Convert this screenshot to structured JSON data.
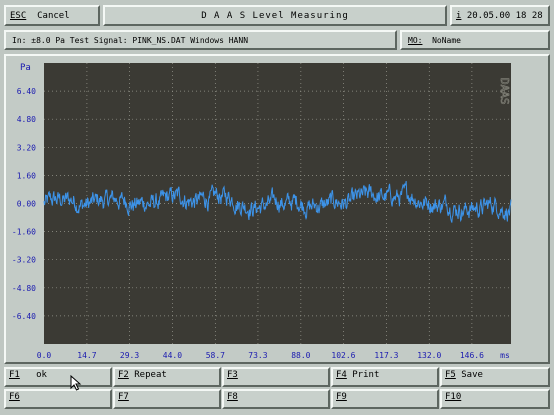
{
  "topbar": {
    "esc_key": "ESC",
    "cancel_label": "Cancel",
    "title": "D A A S  Level Measuring",
    "info_key": "i",
    "datetime": "20.05.00 18 28"
  },
  "infobar": {
    "signal_text": "In: ±8.0 Pa Test Signal: PINK_NS.DAT  Windows HANN",
    "mo_key": "MO:",
    "mo_value": "NoName"
  },
  "chart_data": {
    "type": "line",
    "ylabel": "Pa",
    "xunit": "ms",
    "watermark": "DAAS",
    "ylim": [
      -8.0,
      8.0
    ],
    "yticks": [
      6.4,
      4.8,
      3.2,
      1.6,
      0.0,
      -1.6,
      -3.2,
      -4.8,
      -6.4
    ],
    "ytick_labels": [
      "6.40",
      "4.80",
      "3.20",
      "1.60",
      "0.00",
      "-1.60",
      "-3.20",
      "-4.80",
      "-6.40"
    ],
    "xlim": [
      0,
      160
    ],
    "xticks": [
      0.0,
      14.7,
      29.3,
      44.0,
      58.7,
      73.3,
      88.0,
      102.6,
      117.3,
      132.0,
      146.6
    ],
    "xtick_labels": [
      "0.0",
      "14.7",
      "29.3",
      "44.0",
      "58.7",
      "73.3",
      "88.0",
      "102.6",
      "117.3",
      "132.0",
      "146.6"
    ],
    "grid": true,
    "series": [
      {
        "signal": "pink noise",
        "mean": 0.0,
        "amplitude": 1.2,
        "x_start": 0.0,
        "x_end": 160.0,
        "color": "#3d93e8"
      }
    ],
    "colors": {
      "background": "#3b3a34",
      "grid": "#9a9a90",
      "axis_labels": "#1a1ab0"
    }
  },
  "fkeys": [
    {
      "key": "F1",
      "label": "ok"
    },
    {
      "key": "F2",
      "label": "Repeat"
    },
    {
      "key": "F3",
      "label": ""
    },
    {
      "key": "F4",
      "label": "Print"
    },
    {
      "key": "F5",
      "label": "Save"
    },
    {
      "key": "F6",
      "label": ""
    },
    {
      "key": "F7",
      "label": ""
    },
    {
      "key": "F8",
      "label": ""
    },
    {
      "key": "F9",
      "label": ""
    },
    {
      "key": "F10",
      "label": ""
    }
  ]
}
